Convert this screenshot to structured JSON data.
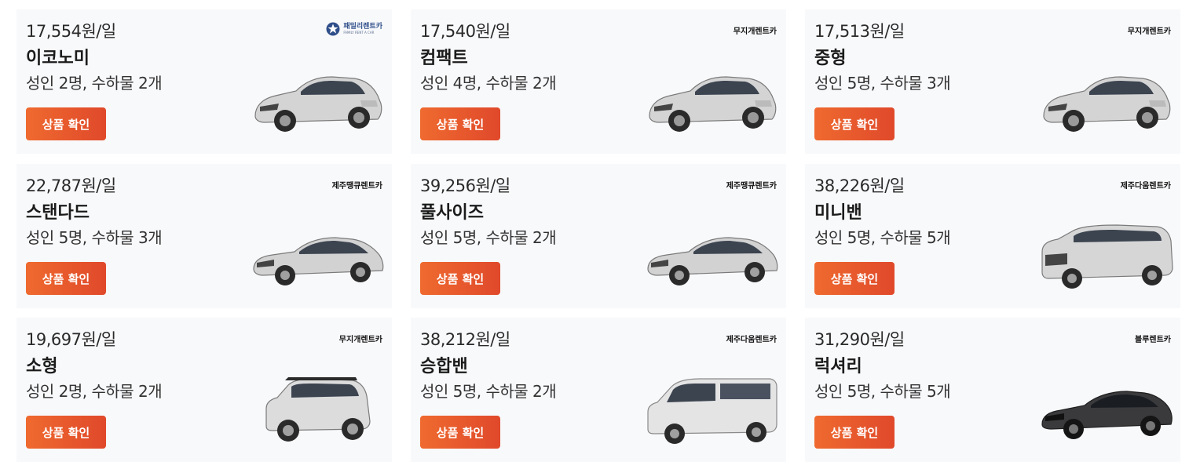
{
  "cards": [
    {
      "price": "17,554원/일",
      "car_type": "이코노미",
      "capacity": "성인 2명, 수하물 2개",
      "button": "상품 확인",
      "company": "패밀리렌트카",
      "company_sub": "FAMILY RENT A CAR",
      "car_color": "#d4d4d4",
      "car_icon": "hatchback-car-icon"
    },
    {
      "price": "17,540원/일",
      "car_type": "컴팩트",
      "capacity": "성인 4명, 수하물 2개",
      "button": "상품 확인",
      "company": "무지개렌트카",
      "car_color": "#d4d4d4",
      "car_icon": "hatchback-car-icon"
    },
    {
      "price": "17,513원/일",
      "car_type": "중형",
      "capacity": "성인 5명, 수하물 3개",
      "button": "상품 확인",
      "company": "무지개렌트카",
      "car_color": "#d4d4d4",
      "car_icon": "hatchback-car-icon"
    },
    {
      "price": "22,787원/일",
      "car_type": "스탠다드",
      "capacity": "성인 5명, 수하물 3개",
      "button": "상품 확인",
      "company": "제주땡큐렌트카",
      "car_color": "#d2d2d2",
      "car_icon": "sedan-car-icon"
    },
    {
      "price": "39,256원/일",
      "car_type": "풀사이즈",
      "capacity": "성인 5명, 수하물 2개",
      "button": "상품 확인",
      "company": "제주땡큐렌트카",
      "car_color": "#d2d2d2",
      "car_icon": "sedan-car-icon"
    },
    {
      "price": "38,226원/일",
      "car_type": "미니밴",
      "capacity": "성인 5명, 수하물 5개",
      "button": "상품 확인",
      "company": "제주다움렌트카",
      "car_color": "#d6d6d6",
      "car_icon": "minivan-car-icon"
    },
    {
      "price": "19,697원/일",
      "car_type": "소형",
      "capacity": "성인 2명, 수하물 2개",
      "button": "상품 확인",
      "company": "무지개렌트카",
      "car_color": "#dcdcdc",
      "car_icon": "mini-car-icon"
    },
    {
      "price": "38,212원/일",
      "car_type": "승합밴",
      "capacity": "성인 5명, 수하물 2개",
      "button": "상품 확인",
      "company": "제주다움렌트카",
      "car_color": "#e4e4e4",
      "car_icon": "van-car-icon"
    },
    {
      "price": "31,290원/일",
      "car_type": "럭셔리",
      "capacity": "성인 5명, 수하물 5개",
      "button": "상품 확인",
      "company": "블루렌트카",
      "car_color": "#3a3a3c",
      "car_icon": "luxury-sedan-car-icon"
    }
  ],
  "colors": {
    "accent_start": "#ef6a2f",
    "accent_end": "#e0492b",
    "card_bg": "#f8f9fb"
  }
}
